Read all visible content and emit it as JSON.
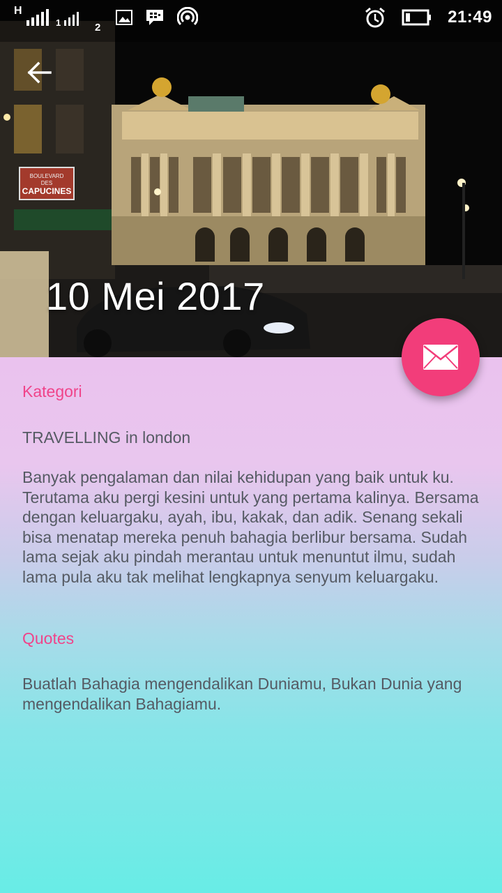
{
  "status_bar": {
    "network_type": "H",
    "sim1": "1",
    "sim2": "2",
    "time": "21:49"
  },
  "header": {
    "date_title": "10 Mei 2017",
    "sign_text_1": "BOULEVARD",
    "sign_text_2": "DES",
    "sign_text_3": "CAPUCINES"
  },
  "entry": {
    "category_label": "Kategori",
    "category_value": "TRAVELLING in london",
    "story": "Banyak pengalaman dan nilai kehidupan yang baik untuk ku. Terutama aku pergi kesini untuk yang pertama kalinya. Bersama dengan keluargaku, ayah, ibu, kakak, dan adik. Senang sekali bisa menatap mereka penuh bahagia berlibur bersama. Sudah lama sejak aku pindah merantau untuk menuntut ilmu, sudah lama pula aku tak melihat lengkapnya senyum keluargaku.",
    "quotes_label": "Quotes",
    "quote": "Buatlah Bahagia mengendalikan Duniamu, Bukan Dunia yang mengendalikan Bahagiamu."
  },
  "colors": {
    "accent": "#f23d7a",
    "label": "#f0448a",
    "text": "#555a63"
  },
  "icons": {
    "back": "arrow-left-icon",
    "fab": "envelope-icon"
  }
}
